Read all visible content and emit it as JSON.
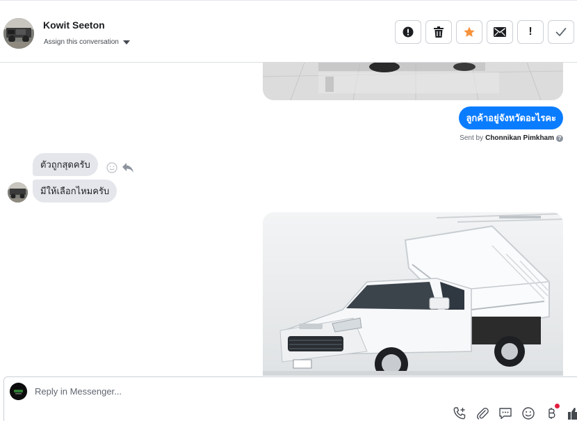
{
  "header": {
    "contact_name": "Kowit Seeton",
    "assign_label": "Assign this conversation",
    "actions": [
      {
        "icon": "alert-circle-icon"
      },
      {
        "icon": "trash-icon"
      },
      {
        "icon": "star-icon",
        "color": "#f7923b"
      },
      {
        "icon": "envelope-icon"
      },
      {
        "icon": "exclamation-icon",
        "label": "!"
      },
      {
        "icon": "check-icon"
      }
    ]
  },
  "messages": {
    "outgoing_text": "ลูกค้าอยู่จังหวัดอะไรคะ",
    "sent_by_prefix": "Sent by",
    "sent_by_name": "Chonnikan Pimkham",
    "help_mark": "?",
    "incoming": [
      {
        "text": "ตัวถูกสุดครับ"
      },
      {
        "text": "มีให้เลือกไหมครับ"
      }
    ]
  },
  "composer": {
    "placeholder": "Reply in Messenger...",
    "tools": [
      "phone-add-icon",
      "paperclip-icon",
      "chat-icon",
      "emoji-icon",
      "baht-icon",
      "thumbs-up-icon"
    ]
  },
  "colors": {
    "accent": "#0a7cff",
    "incoming_bubble": "#e4e6eb",
    "notification_dot": "#e41e3f"
  }
}
